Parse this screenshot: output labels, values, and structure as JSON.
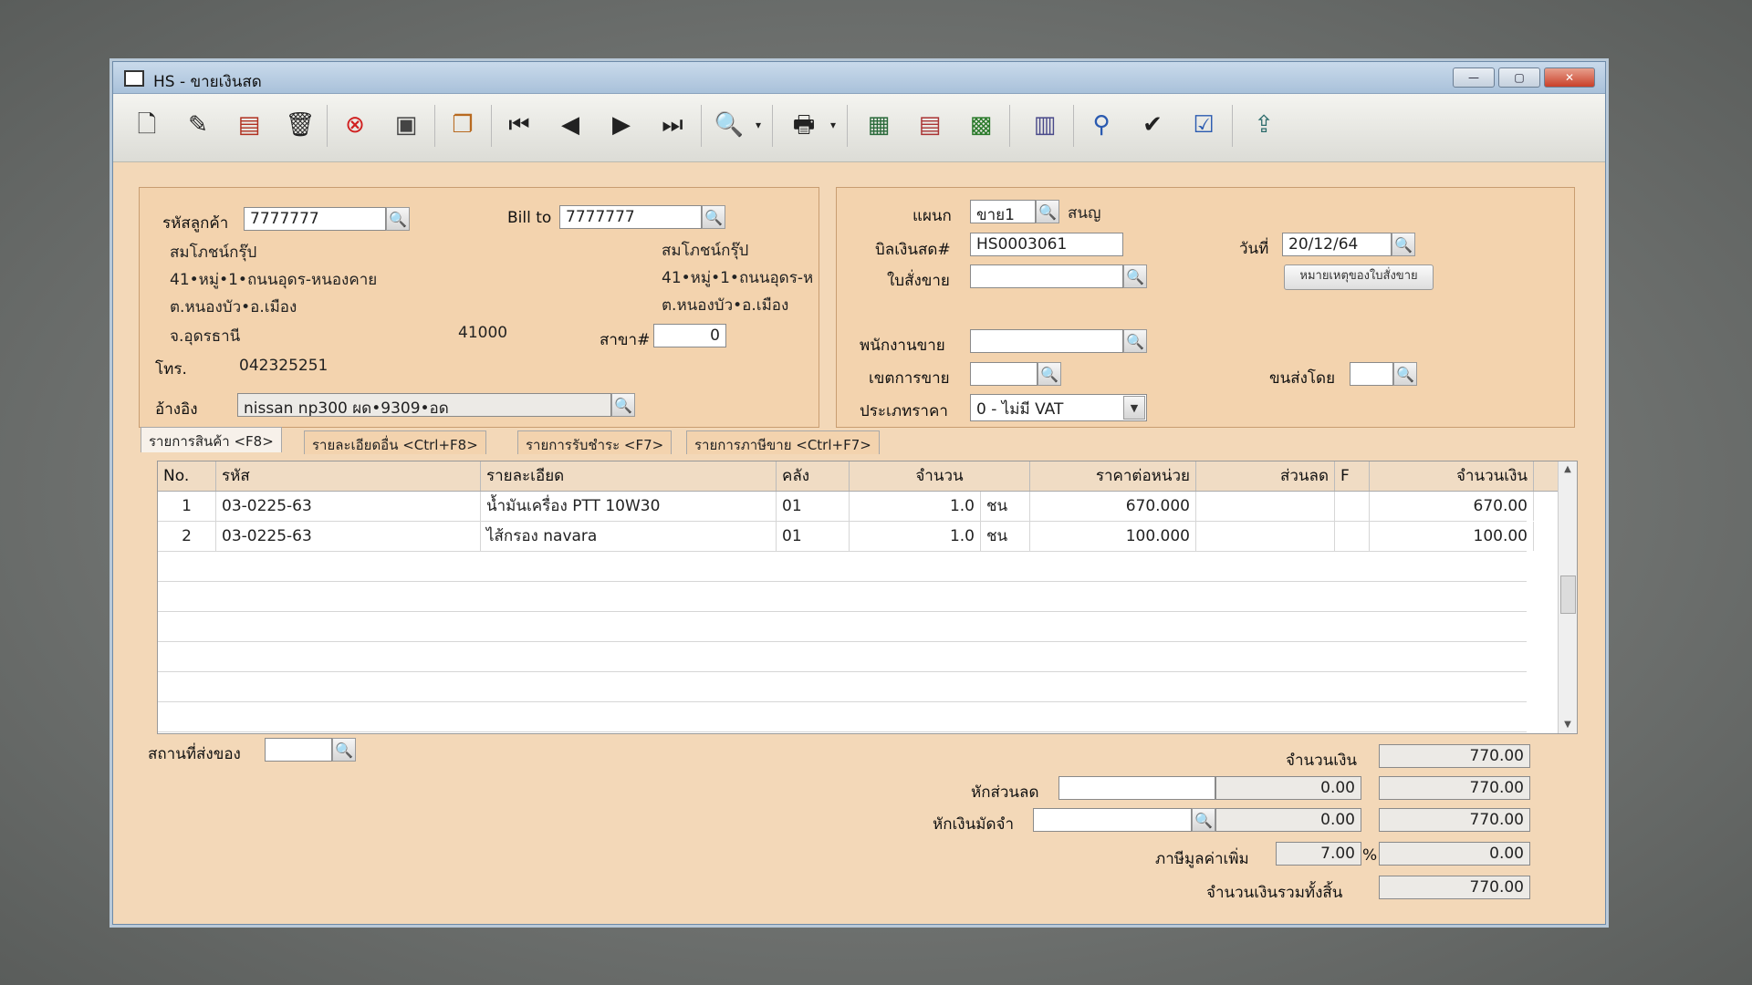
{
  "window": {
    "title": "HS - ขายเงินสด",
    "min": "—",
    "max": "▢",
    "close": "✕"
  },
  "toolbar": {
    "icons": [
      "new-icon",
      "edit-icon",
      "invoice-icon",
      "delete-icon",
      "cancel-icon",
      "save-icon",
      "copy-icon",
      "first-record-icon",
      "previous-record-icon",
      "next-record-icon",
      "last-record-icon",
      "search-icon",
      "print-icon",
      "calculator-icon",
      "register-icon",
      "cash-icon",
      "report-icon",
      "stamp-ok-icon",
      "approve-icon",
      "ok-icon",
      "export-icon"
    ]
  },
  "customer": {
    "code_label": "รหัสลูกค้า",
    "code": "7777777",
    "bill_to_label": "Bill to",
    "bill_to": "7777777",
    "name": "สมโภชน์กรุ๊ป",
    "address1": "41•หมู่•1•ถนนอุดร-หนองคาย",
    "address2": "ต.หนองบัว•อ.เมือง",
    "province": "จ.อุดรธานี",
    "postcode": "41000",
    "billto_name": "สมโภชน์กรุ๊ป",
    "billto_address1": "41•หมู่•1•ถนนอุดร-ห",
    "billto_address2": "ต.หนองบัว•อ.เมือง",
    "branch_label": "สาขา#",
    "branch": "0",
    "phone_label": "โทร.",
    "phone": "042325251",
    "ref_label": "อ้างอิง",
    "ref": "nissan np300 ผด•9309•อด"
  },
  "doc": {
    "dept_label": "แผนก",
    "dept": "ขาย1",
    "dept_name": "สนญ",
    "bill_label": "บิลเงินสด#",
    "bill_no": "HS0003061",
    "date_label": "วันที่",
    "date": "20/12/64",
    "order_label": "ใบสั่งขาย",
    "order": "",
    "order_note_button": "หมายเหตุของใบสั่งขาย",
    "salesman_label": "พนักงานขาย",
    "salesman": "",
    "area_label": "เขตการขาย",
    "area": "",
    "ship_by_label": "ขนส่งโดย",
    "ship_by": "",
    "price_type_label": "ประเภทราคา",
    "price_type": "0 - ไม่มี VAT"
  },
  "tabs": [
    {
      "label": "รายการสินค้า <F8>"
    },
    {
      "label": "รายละเอียดอื่น <Ctrl+F8>"
    },
    {
      "label": "รายการรับชำระ <F7>"
    },
    {
      "label": "รายการภาษีขาย <Ctrl+F7>"
    }
  ],
  "grid": {
    "headers": [
      "No.",
      "รหัส",
      "รายละเอียด",
      "คลัง",
      "จำนวน",
      "ราคาต่อหน่วย",
      "ส่วนลด",
      "F",
      "จำนวนเงิน"
    ],
    "rows": [
      {
        "no": "1",
        "code": "03-0225-63",
        "desc": "น้ำมันเครื่อง PTT 10W30",
        "wh": "01",
        "qty": "1.0",
        "unit": "ชน",
        "price": "670.000",
        "disc": "",
        "f": "",
        "amount": "670.00"
      },
      {
        "no": "2",
        "code": "03-0225-63",
        "desc": "ไส้กรอง navara",
        "wh": "01",
        "qty": "1.0",
        "unit": "ชน",
        "price": "100.000",
        "disc": "",
        "f": "",
        "amount": "100.00"
      }
    ]
  },
  "footer": {
    "ship_place_label": "สถานที่ส่งของ",
    "ship_place": "",
    "amount_label": "จำนวนเงิน",
    "amount": "770.00",
    "discount_label": "หักส่วนลด",
    "discount_input": "",
    "discount_value": "0.00",
    "after_discount": "770.00",
    "deposit_label": "หักเงินมัดจำ",
    "deposit_input": "",
    "deposit_value": "0.00",
    "after_deposit": "770.00",
    "vat_label": "ภาษีมูลค่าเพิ่ม",
    "vat_rate": "7.00",
    "vat_percent": "%",
    "vat_amount": "0.00",
    "total_label": "จำนวนเงินรวมทั้งสิ้น",
    "total": "770.00"
  }
}
